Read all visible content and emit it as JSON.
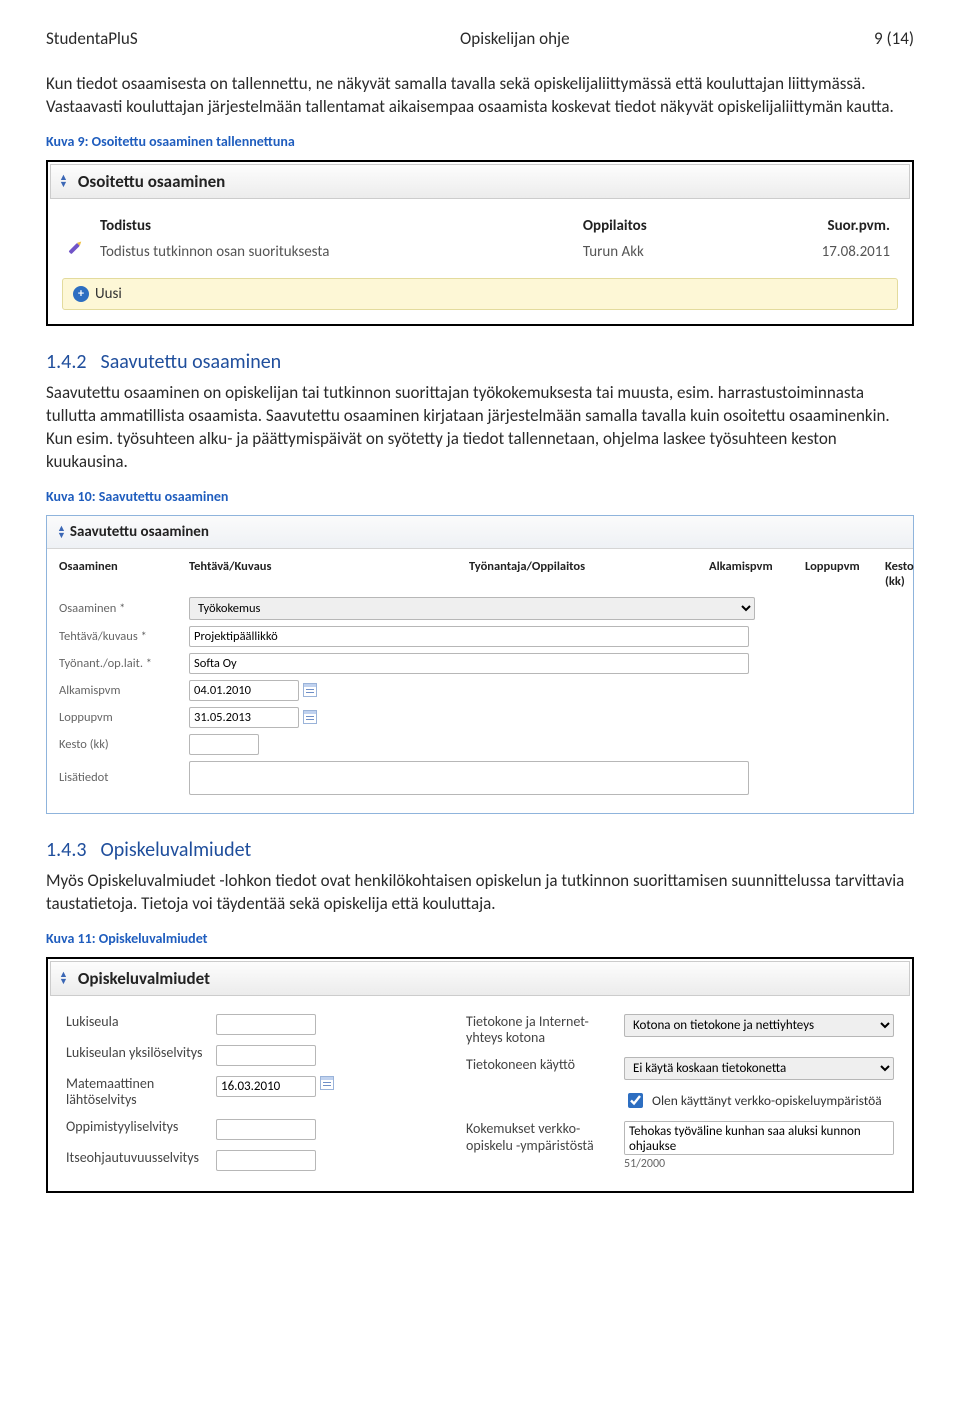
{
  "header": {
    "left": "StudentaPluS",
    "center": "Opiskelijan ohje",
    "right": "9 (14)"
  },
  "paragraphs": [
    "Kun tiedot osaamisesta on tallennettu, ne näkyvät samalla tavalla sekä opiskelijaliittymässä että kouluttajan liittymässä. Vastaavasti kouluttajan järjestelmään tallentamat aikaisempaa osaamista koskevat tiedot näkyvät opiskelijaliittymän kautta.",
    "Saavutettu osaaminen on opiskelijan tai tutkinnon suorittajan työkokemuksesta tai muusta, esim. harrastustoiminnasta tullutta ammatillista osaamista. Saavutettu osaaminen kirjataan järjestelmään samalla tavalla kuin osoitettu osaaminenkin. Kun esim. työsuhteen alku- ja päättymispäivät on syötetty ja tiedot tallennetaan, ohjelma laskee työsuhteen keston kuukausina.",
    "Myös Opiskeluvalmiudet -lohkon tiedot ovat henkilökohtaisen opiskelun ja tutkinnon suorittamisen suunnittelussa tarvittavia taustatietoja. Tietoja voi täydentää sekä opiskelija että kouluttaja."
  ],
  "captions": {
    "kuva9": "Kuva 9: Osoitettu osaaminen tallennettuna",
    "kuva10": "Kuva 10: Saavutettu osaaminen",
    "kuva11": "Kuva 11: Opiskeluvalmiudet"
  },
  "sections": {
    "s142": {
      "num": "1.4.2",
      "title": "Saavutettu osaaminen"
    },
    "s143": {
      "num": "1.4.3",
      "title": "Opiskeluvalmiudet"
    }
  },
  "panel1": {
    "title": "Osoitettu osaaminen",
    "columns": [
      "Todistus",
      "Oppilaitos",
      "Suor.pvm."
    ],
    "rows": [
      {
        "todistus": "Todistus tutkinnon osan suorituksesta",
        "oppilaitos": "Turun Akk",
        "pvm": "17.08.2011"
      }
    ],
    "uusi": "Uusi"
  },
  "panel2": {
    "title": "Saavutettu osaaminen",
    "columns": [
      "Osaaminen",
      "Tehtävä/Kuvaus",
      "Työnantaja/Oppilaitos",
      "Alkamispvm",
      "Loppupvm",
      "Kesto (kk)"
    ],
    "fields": [
      {
        "label": "Osaaminen *",
        "value": "Työkokemus"
      },
      {
        "label": "Tehtävä/kuvaus *",
        "value": "Projektipäällikkö"
      },
      {
        "label": "Työnant./op.lait. *",
        "value": "Softa Oy"
      },
      {
        "label": "Alkamispvm",
        "value": "04.01.2010"
      },
      {
        "label": "Loppupvm",
        "value": "31.05.2013"
      },
      {
        "label": "Kesto (kk)",
        "value": ""
      },
      {
        "label": "Lisätiedot",
        "value": ""
      }
    ]
  },
  "panel3": {
    "title": "Opiskeluvalmiudet",
    "left": [
      {
        "label": "Lukiseula",
        "value": ""
      },
      {
        "label": "Lukiseulan yksilöselvitys",
        "value": ""
      },
      {
        "label": "Matemaattinen lähtöselvitys",
        "value": "16.03.2010"
      },
      {
        "label": "Oppimistyyliselvitys",
        "value": ""
      },
      {
        "label": "Itseohjautuvuusselvitys",
        "value": ""
      }
    ],
    "right": [
      {
        "label": "Tietokone ja Internet-yhteys kotona",
        "value": "Kotona on tietokone ja nettiyhteys"
      },
      {
        "label": "Tietokoneen käyttö",
        "value": "Ei käytä koskaan tietokonetta"
      },
      {
        "label": "Olen käyttänyt verkko-opiskeluympäristöä",
        "checked": true
      },
      {
        "label": "Kokemukset verkko-opiskelu -ympäristöstä",
        "value": "Tehokas työväline kunhan saa aluksi kunnon ohjaukse",
        "counter": "51/2000"
      }
    ]
  }
}
